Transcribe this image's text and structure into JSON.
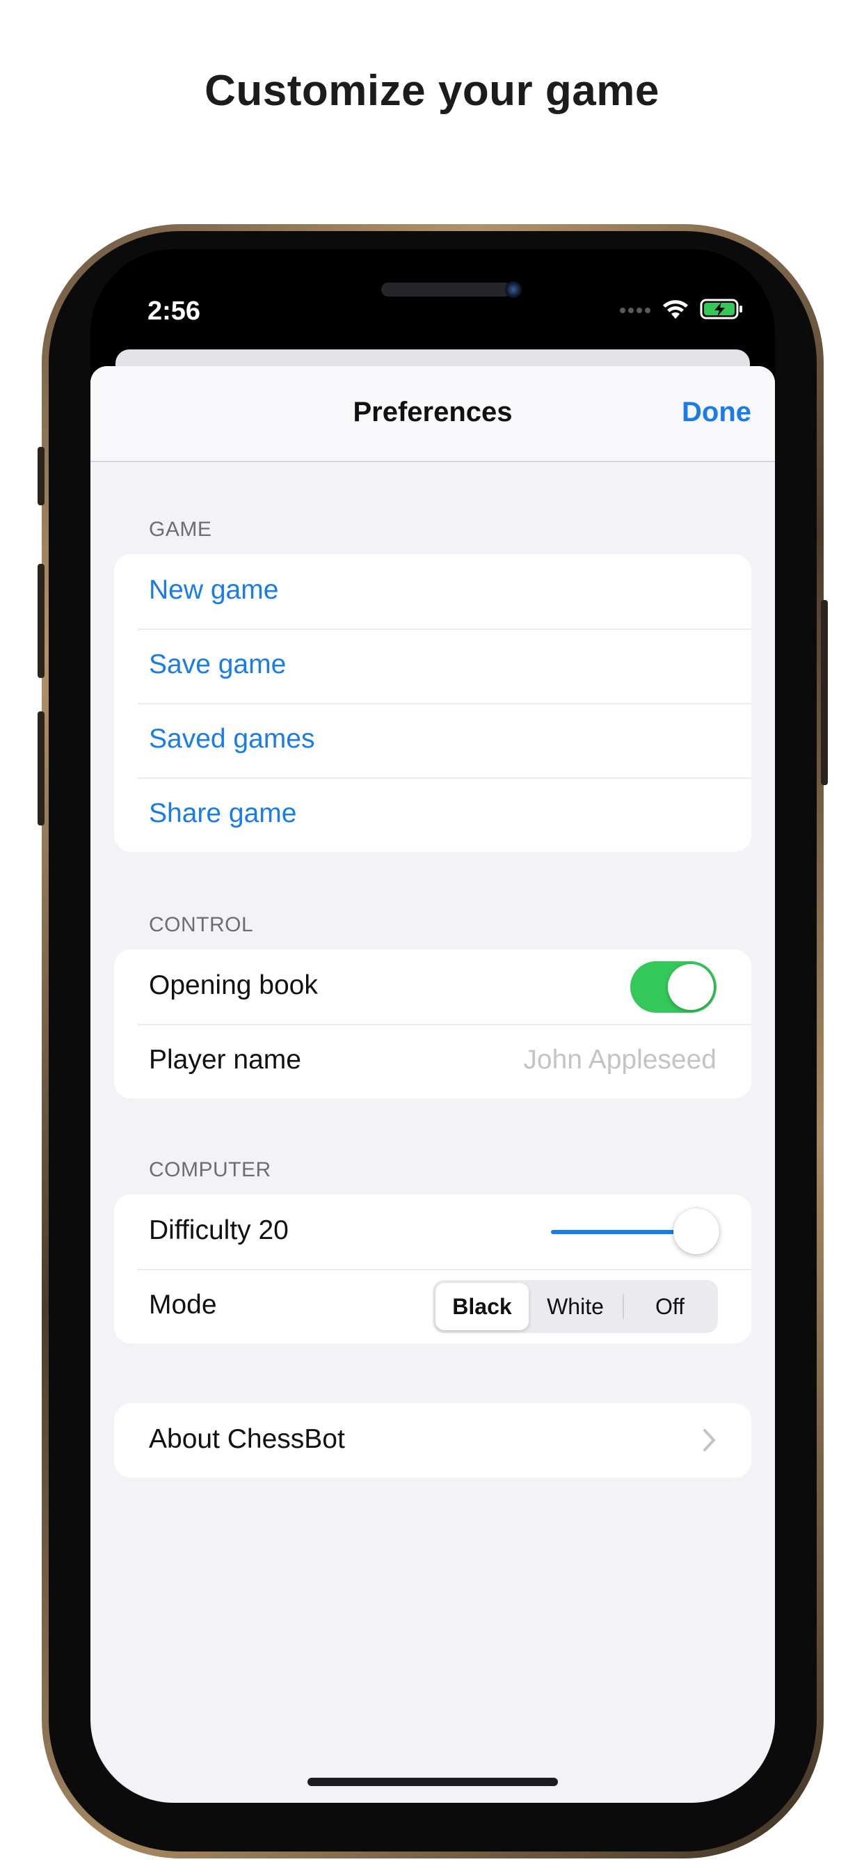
{
  "headline": "Customize your game",
  "status_bar": {
    "time": "2:56"
  },
  "navbar": {
    "title": "Preferences",
    "done_label": "Done"
  },
  "sections": {
    "game": {
      "header": "GAME",
      "items": [
        {
          "label": "New game"
        },
        {
          "label": "Save game"
        },
        {
          "label": "Saved games"
        },
        {
          "label": "Share game"
        }
      ]
    },
    "control": {
      "header": "CONTROL",
      "opening_book": {
        "label": "Opening book",
        "enabled": true
      },
      "player_name": {
        "label": "Player name",
        "placeholder": "John Appleseed"
      }
    },
    "computer": {
      "header": "COMPUTER",
      "difficulty": {
        "label": "Difficulty 20",
        "level_fraction": 1.0
      },
      "mode": {
        "label": "Mode",
        "options": [
          "Black",
          "White",
          "Off"
        ],
        "selected": "Black"
      }
    },
    "about": {
      "label": "About ChessBot"
    }
  },
  "colors": {
    "accent": "#1a7ce6",
    "toggle_on": "#34c759",
    "grouped_background": "#f2f2f7"
  }
}
